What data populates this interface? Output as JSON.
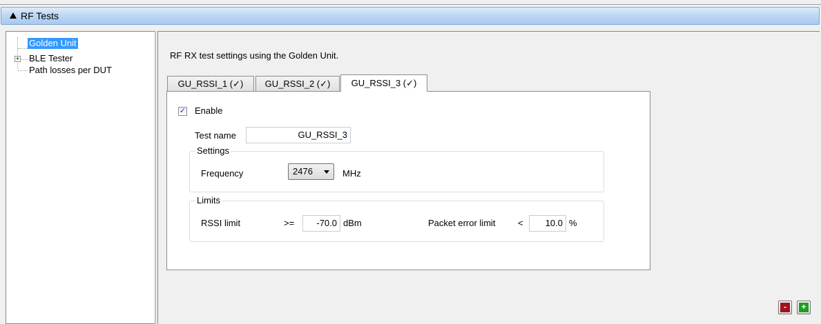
{
  "header": {
    "title": "RF Tests"
  },
  "tree": {
    "items": [
      {
        "label": "Golden Unit",
        "selected": true
      },
      {
        "label": "BLE Tester",
        "expandable": true
      },
      {
        "label": "Path losses per DUT"
      }
    ]
  },
  "main": {
    "description": "RF RX test settings using the Golden Unit.",
    "tabs": [
      {
        "label": "GU_RSSI_1 (✓)"
      },
      {
        "label": "GU_RSSI_2 (✓)"
      },
      {
        "label": "GU_RSSI_3 (✓)",
        "active": true
      }
    ],
    "enable": {
      "label": "Enable",
      "checked": true,
      "mark": "✓"
    },
    "test_name": {
      "label": "Test name",
      "value": "GU_RSSI_3"
    },
    "settings": {
      "title": "Settings",
      "frequency_label": "Frequency",
      "frequency_value": "2476",
      "frequency_unit": "MHz"
    },
    "limits": {
      "title": "Limits",
      "rssi_label": "RSSI limit",
      "rssi_op": ">=",
      "rssi_value": "-70.0",
      "rssi_unit": "dBm",
      "per_label": "Packet error limit",
      "per_op": "<",
      "per_value": "10.0",
      "per_unit": "%"
    }
  },
  "buttons": {
    "remove": {
      "symbol": "-",
      "color": "#a0121c"
    },
    "add": {
      "symbol": "+",
      "color": "#1e9e1e"
    }
  }
}
